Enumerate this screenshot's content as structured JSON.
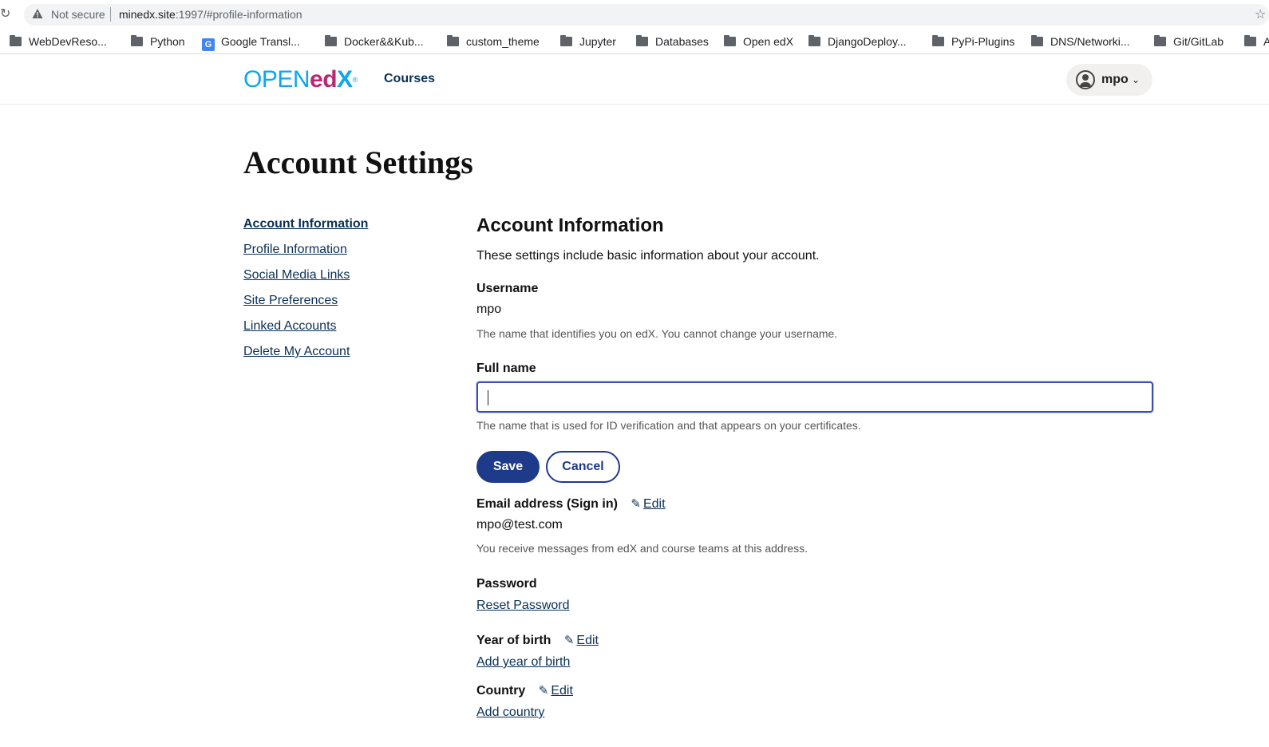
{
  "browser": {
    "security_label": "Not secure",
    "url_host": "minedx.site",
    "url_rest": ":1997/#profile-information",
    "bookmarks": [
      {
        "label": "WebDevReso...",
        "icon": "folder-icon"
      },
      {
        "label": "Python",
        "icon": "folder-icon"
      },
      {
        "label": "Google Transl...",
        "icon": "google-translate-icon"
      },
      {
        "label": "Docker&&Kub...",
        "icon": "folder-icon"
      },
      {
        "label": "custom_theme",
        "icon": "folder-icon"
      },
      {
        "label": "Jupyter",
        "icon": "folder-icon"
      },
      {
        "label": "Databases",
        "icon": "folder-icon"
      },
      {
        "label": "Open edX",
        "icon": "folder-icon"
      },
      {
        "label": "DjangoDeploy...",
        "icon": "folder-icon"
      },
      {
        "label": "PyPi-Plugins",
        "icon": "folder-icon"
      },
      {
        "label": "DNS/Networki...",
        "icon": "folder-icon"
      },
      {
        "label": "Git/GitLab",
        "icon": "folder-icon"
      },
      {
        "label": "A",
        "icon": "folder-icon"
      }
    ]
  },
  "header": {
    "logo_open": "OPEN",
    "logo_ed": "ed",
    "logo_x": "X",
    "courses_label": "Courses",
    "username": "mpo"
  },
  "page": {
    "title": "Account Settings"
  },
  "sidebar": {
    "items": [
      {
        "label": "Account Information",
        "active": true
      },
      {
        "label": "Profile Information",
        "active": false
      },
      {
        "label": "Social Media Links",
        "active": false
      },
      {
        "label": "Site Preferences",
        "active": false
      },
      {
        "label": "Linked Accounts",
        "active": false
      },
      {
        "label": "Delete My Account",
        "active": false
      }
    ]
  },
  "main": {
    "section_title": "Account Information",
    "section_desc": "These settings include basic information about your account.",
    "username": {
      "label": "Username",
      "value": "mpo",
      "help": "The name that identifies you on edX. You cannot change your username."
    },
    "full_name": {
      "label": "Full name",
      "value": "",
      "help": "The name that is used for ID verification and that appears on your certificates.",
      "save_label": "Save",
      "cancel_label": "Cancel"
    },
    "email": {
      "label": "Email address (Sign in)",
      "edit_label": "Edit",
      "value": "mpo@test.com",
      "help": "You receive messages from edX and course teams at this address."
    },
    "password": {
      "label": "Password",
      "link_label": "Reset Password"
    },
    "year_of_birth": {
      "label": "Year of birth",
      "edit_label": "Edit",
      "link_label": "Add year of birth"
    },
    "country": {
      "label": "Country",
      "edit_label": "Edit",
      "link_label": "Add country"
    }
  },
  "colors": {
    "primary": "#1e3a8a",
    "link": "#0a3055",
    "logo_blue": "#0ea6ec",
    "logo_magenta": "#b82870"
  }
}
